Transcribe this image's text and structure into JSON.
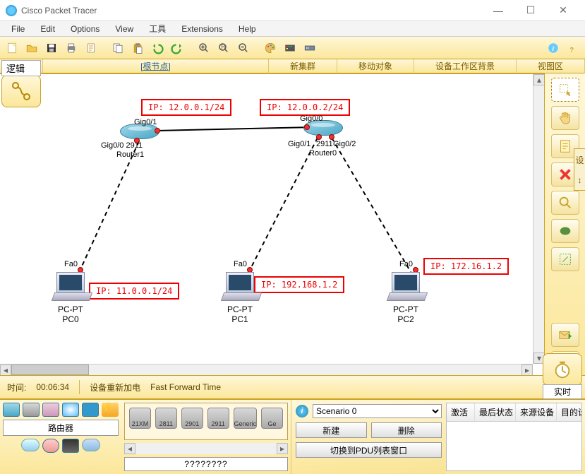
{
  "window": {
    "title": "Cisco Packet Tracer",
    "min": "—",
    "max": "☐",
    "close": "✕"
  },
  "menu": {
    "file": "File",
    "edit": "Edit",
    "options": "Options",
    "view": "View",
    "tools": "工具",
    "extensions": "Extensions",
    "help": "Help"
  },
  "tabbar": {
    "root": "[根节点]",
    "new_cluster": "新集群",
    "move_object": "移动对象",
    "device_bg": "设备工作区背景",
    "viewport": "视图区"
  },
  "logical_label": "逻辑",
  "annotations": {
    "a1": "IP: 12.0.0.1/24",
    "a2": "IP: 12.0.0.2/24",
    "a3": "IP: 11.0.0.1/24",
    "a4": "IP: 192.168.1.2",
    "a5": "IP: 172.16.1.2"
  },
  "devices": {
    "router1": {
      "name": "Router1",
      "if_top": "Gig0/1",
      "if_bottom": "Gig0/0 2911"
    },
    "router0": {
      "name": "Router0",
      "if_left": "Gig0/0",
      "if_bottom_l": "Gig0/1",
      "if_bottom_m": "2911",
      "if_bottom_r": "Gig0/2"
    },
    "pc0": {
      "type": "PC-PT",
      "name": "PC0",
      "iface": "Fa0"
    },
    "pc1": {
      "type": "PC-PT",
      "name": "PC1",
      "iface": "Fa0"
    },
    "pc2": {
      "type": "PC-PT",
      "name": "PC2",
      "iface": "Fa0"
    }
  },
  "timebar": {
    "time_label": "时间:",
    "time_value": "00:06:34",
    "power_cycle": "设备重新加电",
    "fast_forward": "Fast Forward Time"
  },
  "realtime_label": "实时",
  "palette": {
    "category": "路由器"
  },
  "models": {
    "list": [
      "21XM",
      "2811",
      "2901",
      "2911",
      "Generic",
      "Ge"
    ],
    "selected": "????????"
  },
  "scenario": {
    "options": [
      "Scenario 0"
    ],
    "new": "新建",
    "delete": "删除",
    "toggle": "切换到PDU列表窗口"
  },
  "pdu_headers": {
    "fire": "激活",
    "last": "最后状态",
    "src": "来源设备",
    "dst": "目的设备"
  }
}
